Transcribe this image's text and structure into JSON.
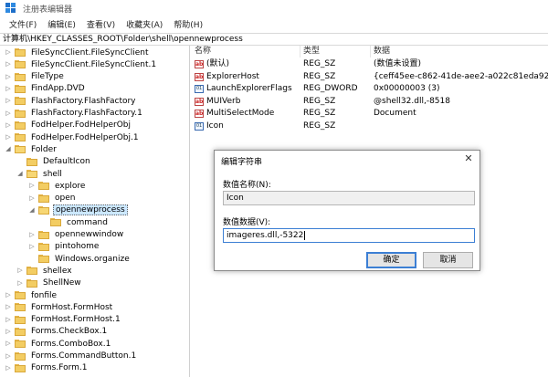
{
  "window": {
    "title": "注册表编辑器"
  },
  "menu": [
    "文件(F)",
    "编辑(E)",
    "查看(V)",
    "收藏夹(A)",
    "帮助(H)"
  ],
  "address": "计算机\\HKEY_CLASSES_ROOT\\Folder\\shell\\opennewprocess",
  "tree": [
    {
      "label": "FileSyncClient.FileSyncClient",
      "indent": 0,
      "expander": "right"
    },
    {
      "label": "FileSyncClient.FileSyncClient.1",
      "indent": 0,
      "expander": "right"
    },
    {
      "label": "FileType",
      "indent": 0,
      "expander": "right"
    },
    {
      "label": "FindApp.DVD",
      "indent": 0,
      "expander": "right"
    },
    {
      "label": "FlashFactory.FlashFactory",
      "indent": 0,
      "expander": "right"
    },
    {
      "label": "FlashFactory.FlashFactory.1",
      "indent": 0,
      "expander": "right"
    },
    {
      "label": "FodHelper.FodHelperObj",
      "indent": 0,
      "expander": "right"
    },
    {
      "label": "FodHelper.FodHelperObj.1",
      "indent": 0,
      "expander": "right"
    },
    {
      "label": "Folder",
      "indent": 0,
      "expander": "down"
    },
    {
      "label": "DefaultIcon",
      "indent": 1,
      "expander": "none"
    },
    {
      "label": "shell",
      "indent": 1,
      "expander": "down"
    },
    {
      "label": "explore",
      "indent": 2,
      "expander": "right"
    },
    {
      "label": "open",
      "indent": 2,
      "expander": "right"
    },
    {
      "label": "opennewprocess",
      "indent": 2,
      "expander": "down",
      "selected": true
    },
    {
      "label": "command",
      "indent": 3,
      "expander": "none"
    },
    {
      "label": "opennewwindow",
      "indent": 2,
      "expander": "right"
    },
    {
      "label": "pintohome",
      "indent": 2,
      "expander": "right"
    },
    {
      "label": "Windows.organize",
      "indent": 2,
      "expander": "none"
    },
    {
      "label": "shellex",
      "indent": 1,
      "expander": "right"
    },
    {
      "label": "ShellNew",
      "indent": 1,
      "expander": "right"
    },
    {
      "label": "fonfile",
      "indent": 0,
      "expander": "right"
    },
    {
      "label": "FormHost.FormHost",
      "indent": 0,
      "expander": "right"
    },
    {
      "label": "FormHost.FormHost.1",
      "indent": 0,
      "expander": "right"
    },
    {
      "label": "Forms.CheckBox.1",
      "indent": 0,
      "expander": "right"
    },
    {
      "label": "Forms.ComboBox.1",
      "indent": 0,
      "expander": "right"
    },
    {
      "label": "Forms.CommandButton.1",
      "indent": 0,
      "expander": "right"
    },
    {
      "label": "Forms.Form.1",
      "indent": 0,
      "expander": "right"
    }
  ],
  "columns": {
    "name": "名称",
    "type": "类型",
    "data": "数据"
  },
  "values": [
    {
      "name": "(默认)",
      "type": "REG_SZ",
      "data": "(数值未设置)",
      "icon": "ab"
    },
    {
      "name": "ExplorerHost",
      "type": "REG_SZ",
      "data": "{ceff45ee-c862-41de-aee2-a022c81eda92}",
      "icon": "ab"
    },
    {
      "name": "LaunchExplorerFlags",
      "type": "REG_DWORD",
      "data": "0x00000003 (3)",
      "icon": "bin"
    },
    {
      "name": "MUIVerb",
      "type": "REG_SZ",
      "data": "@shell32.dll,-8518",
      "icon": "ab"
    },
    {
      "name": "MultiSelectMode",
      "type": "REG_SZ",
      "data": "Document",
      "icon": "ab"
    },
    {
      "name": "Icon",
      "type": "REG_SZ",
      "data": "",
      "icon": "bin"
    }
  ],
  "dialog": {
    "title": "编辑字符串",
    "name_label": "数值名称(N):",
    "name_value": "Icon",
    "data_label": "数值数据(V):",
    "data_value": "imageres.dll,-5322",
    "ok": "确定",
    "cancel": "取消"
  }
}
